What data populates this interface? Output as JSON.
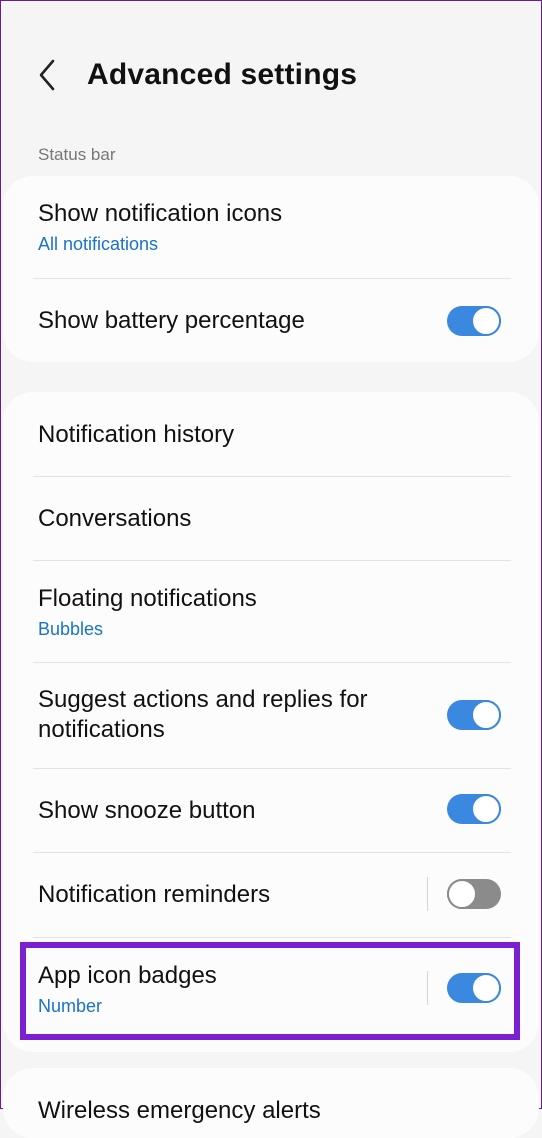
{
  "header": {
    "title": "Advanced settings",
    "back_icon": "chevron-left-icon"
  },
  "status_bar_section": {
    "label": "Status bar",
    "items": [
      {
        "title": "Show notification icons",
        "subtitle": "All notifications"
      },
      {
        "title": "Show battery percentage",
        "toggle": true
      }
    ]
  },
  "notifications_section": {
    "items": [
      {
        "title": "Notification history"
      },
      {
        "title": "Conversations"
      },
      {
        "title": "Floating notifications",
        "subtitle": "Bubbles"
      },
      {
        "title_line1": "Suggest actions and replies for",
        "title_line2": "notifications",
        "toggle": true
      },
      {
        "title": "Show snooze button",
        "toggle": true
      },
      {
        "title": "Notification reminders",
        "toggle": false
      },
      {
        "title": "App icon badges",
        "subtitle": "Number",
        "toggle": true
      }
    ]
  },
  "next_section": {
    "items": [
      {
        "title": "Wireless emergency alerts"
      }
    ]
  },
  "colors": {
    "accent": "#3a88e0",
    "link": "#1a73c7",
    "highlight": "#7b1fd0",
    "toggle_off": "#8b8b8b"
  }
}
